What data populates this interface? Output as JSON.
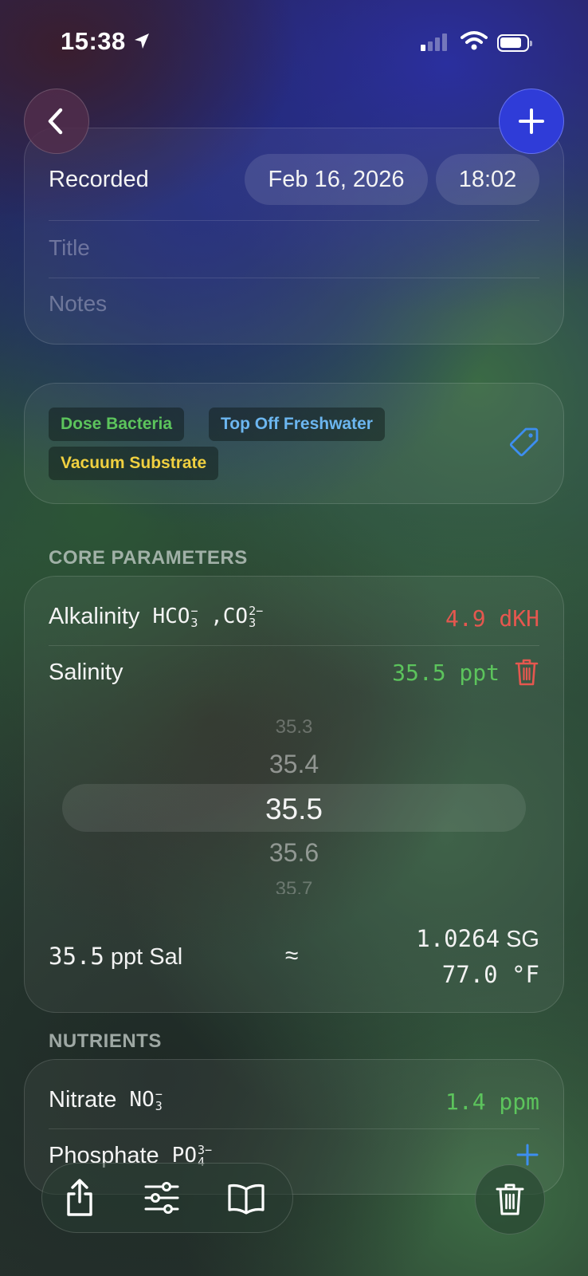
{
  "status_bar": {
    "time": "15:38"
  },
  "nav": {
    "back_icon": "chevron-left-icon",
    "add_icon": "plus-icon"
  },
  "record": {
    "recorded_label": "Recorded",
    "date": "Feb 16, 2026",
    "time": "18:02",
    "title_placeholder": "Title",
    "notes_placeholder": "Notes"
  },
  "tags": {
    "items": [
      {
        "label": "Dose Bacteria",
        "color": "#5cc45c"
      },
      {
        "label": "Top Off Freshwater",
        "color": "#6cb6f0"
      },
      {
        "label": "Vacuum Substrate",
        "color": "#f0d040"
      }
    ],
    "tag_icon": "tag-icon"
  },
  "core": {
    "heading": "CORE PARAMETERS",
    "alkalinity": {
      "label": "Alkalinity",
      "f1_base": "HCO",
      "f1_sub": "3",
      "f1_sup": "−",
      "sep": ",",
      "f2_base": "CO",
      "f2_sub": "3",
      "f2_sup": "2−",
      "value": "4.9 dKH"
    },
    "salinity": {
      "label": "Salinity",
      "value": "35.5 ppt",
      "picker": [
        "35.3",
        "35.4",
        "35.5",
        "35.6",
        "35.7"
      ],
      "selected": "35.5"
    },
    "conversion": {
      "left_num": "35.5",
      "left_unit": " ppt Sal",
      "approx": "≈",
      "sg_num": "1.0264",
      "sg_unit": " SG",
      "temp_num": "77.0",
      "temp_unit": " °F"
    }
  },
  "nutrients": {
    "heading": "NUTRIENTS",
    "nitrate": {
      "label": "Nitrate",
      "f_base": "NO",
      "f_sub": "3",
      "f_sup": "−",
      "value": "1.4 ppm"
    },
    "phosphate": {
      "label": "Phosphate",
      "f_base": "PO",
      "f_sub": "4",
      "f_sup": "3−"
    }
  },
  "colors": {
    "accent_blue": "#2f3cd8",
    "bad": "#e5574f",
    "good": "#5cc45c",
    "link_blue": "#3d8ef0"
  }
}
